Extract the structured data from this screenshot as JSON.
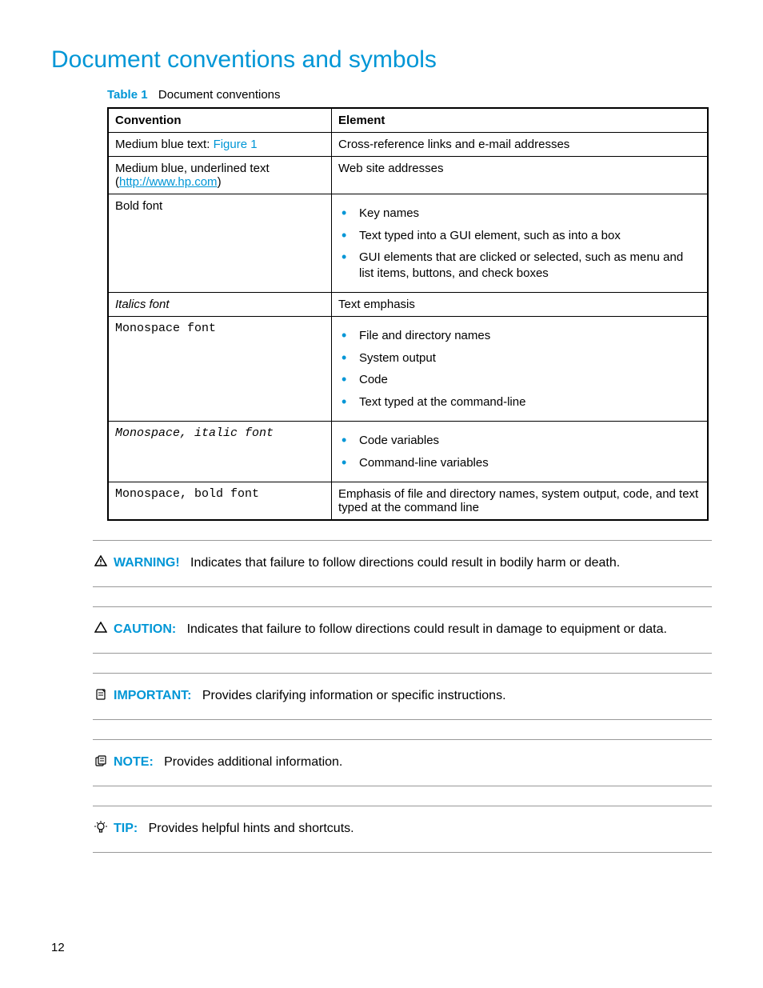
{
  "heading": "Document conventions and symbols",
  "table": {
    "caption_label": "Table 1",
    "caption_title": "Document conventions",
    "headers": {
      "convention": "Convention",
      "element": "Element"
    },
    "rows": {
      "r1": {
        "conv_prefix": "Medium blue text: ",
        "conv_link": "Figure 1",
        "elem_text": "Cross-reference links and e-mail addresses"
      },
      "r2": {
        "conv_line1": "Medium blue, underlined text",
        "conv_open": "(",
        "conv_link": "http://www.hp.com",
        "conv_close": ")",
        "elem_text": "Web site addresses"
      },
      "r3": {
        "conv_text": "Bold font",
        "items": {
          "i1": "Key names",
          "i2": "Text typed into a GUI element, such as into a box",
          "i3": "GUI elements that are clicked or selected, such as menu and list items, buttons, and check boxes"
        }
      },
      "r4": {
        "conv_text": "Italics font",
        "elem_text": "Text emphasis"
      },
      "r5": {
        "conv_text": "Monospace font",
        "items": {
          "i1": "File and directory names",
          "i2": "System output",
          "i3": "Code",
          "i4": "Text typed at the command-line"
        }
      },
      "r6": {
        "conv_text": "Monospace, italic font",
        "items": {
          "i1": "Code variables",
          "i2": "Command-line variables"
        }
      },
      "r7": {
        "conv_text": "Monospace, bold font",
        "elem_text": "Emphasis of file and directory names, system output, code, and text typed at the command line"
      }
    }
  },
  "admonitions": {
    "warning": {
      "label": "WARNING!",
      "text": "Indicates that failure to follow directions could result in bodily harm or death."
    },
    "caution": {
      "label": "CAUTION:",
      "text": "Indicates that failure to follow directions could result in damage to equipment or data."
    },
    "important": {
      "label": "IMPORTANT:",
      "text": "Provides clarifying information or specific instructions."
    },
    "note": {
      "label": "NOTE:",
      "text": "Provides additional information."
    },
    "tip": {
      "label": "TIP:",
      "text": "Provides helpful hints and shortcuts."
    }
  },
  "page_number": "12"
}
